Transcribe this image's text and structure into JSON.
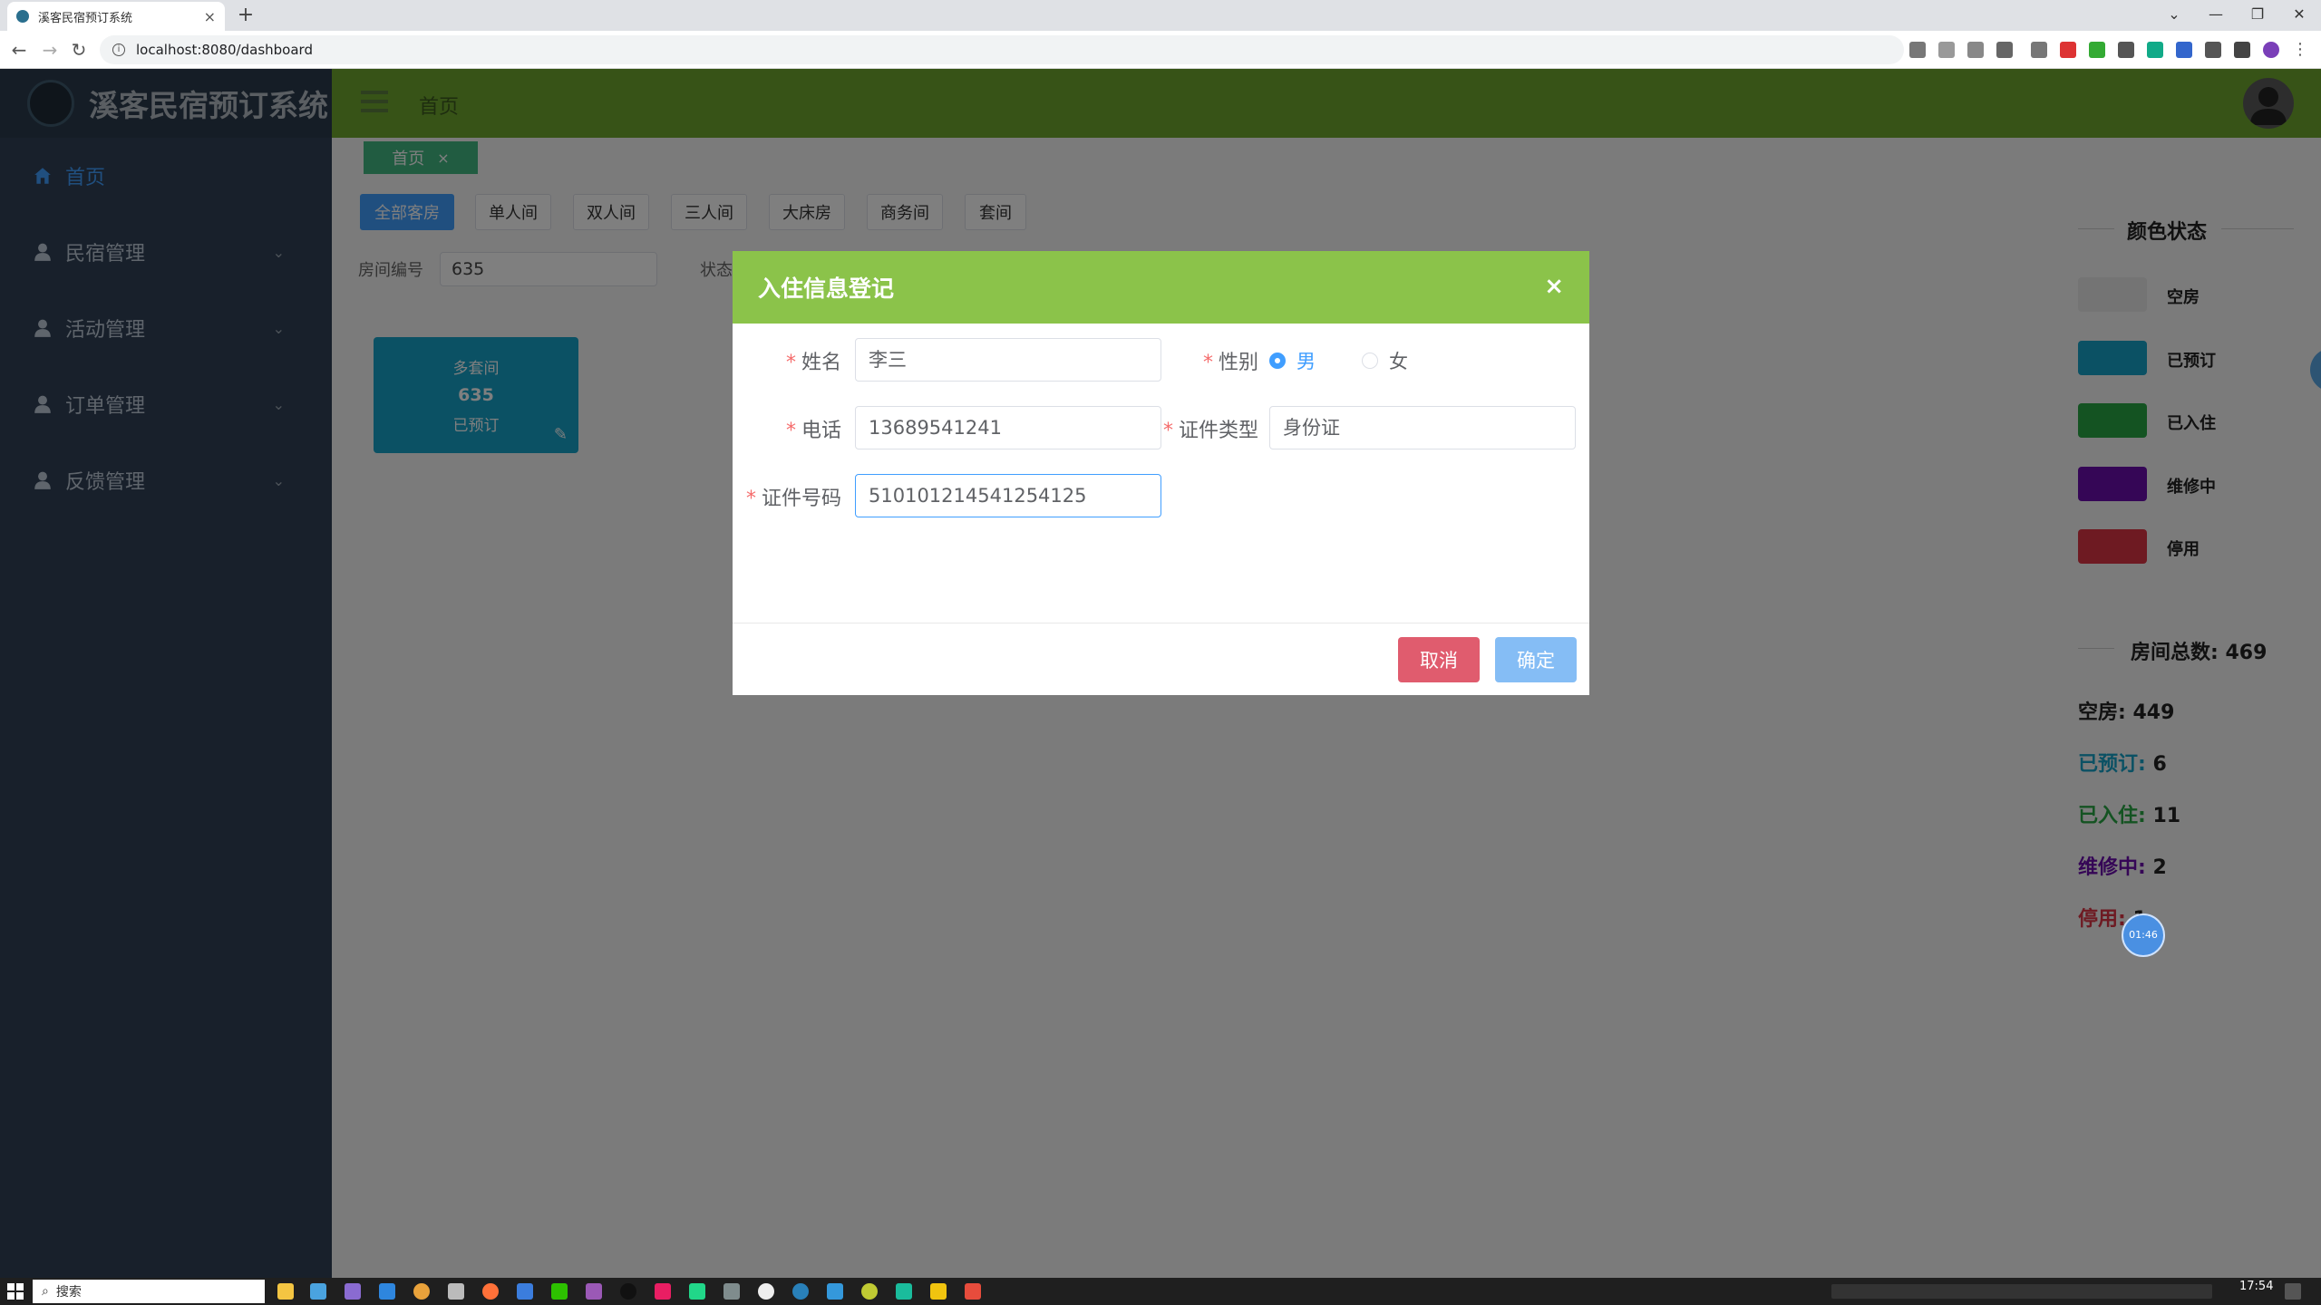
{
  "browser": {
    "tab_title": "溪客民宿预订系统",
    "tab_close": "×",
    "new_tab": "+",
    "url": "localhost:8080/dashboard",
    "window_controls": [
      "⌄",
      "—",
      "❐",
      "✕"
    ]
  },
  "app": {
    "title": "溪客民宿预订系统",
    "header_home": "首页",
    "menu": [
      {
        "label": "首页",
        "icon": "home-icon",
        "active": true
      },
      {
        "label": "民宿管理",
        "icon": "user-icon",
        "expandable": true
      },
      {
        "label": "活动管理",
        "icon": "user-icon",
        "expandable": true
      },
      {
        "label": "订单管理",
        "icon": "user-icon",
        "expandable": true
      },
      {
        "label": "反馈管理",
        "icon": "user-icon",
        "expandable": true
      }
    ],
    "menu_chevron": "⌄"
  },
  "tags": {
    "home": "首页",
    "close": "×"
  },
  "filters": [
    "全部客房",
    "单人间",
    "双人间",
    "三人间",
    "大床房",
    "商务间",
    "套间"
  ],
  "search": {
    "room_no_label": "房间编号",
    "room_no_value": "635",
    "status_label": "状态"
  },
  "room_card": {
    "type": "多套间",
    "number": "635",
    "status": "已预订"
  },
  "color_status": {
    "title": "颜色状态",
    "items": [
      {
        "label": "空房",
        "color": "#e8e8e8"
      },
      {
        "label": "已预订",
        "color": "#17a2c8"
      },
      {
        "label": "已入住",
        "color": "#28a745"
      },
      {
        "label": "维修中",
        "color": "#6a0dad"
      },
      {
        "label": "停用",
        "color": "#dc3545"
      }
    ]
  },
  "room_stats": {
    "total_label": "房间总数: 469",
    "rows": [
      {
        "label": "空房:",
        "value": "449",
        "color": "#222222"
      },
      {
        "label": "已预订:",
        "value": "6",
        "color": "#17a2c8"
      },
      {
        "label": "已入住:",
        "value": "11",
        "color": "#28a745"
      },
      {
        "label": "维修中:",
        "value": "2",
        "color": "#6a0dad"
      },
      {
        "label": "停用:",
        "value": "1",
        "color": "#dc3545"
      }
    ]
  },
  "dialog": {
    "title": "入住信息登记",
    "close": "×",
    "required_mark": "*",
    "name_label": "姓名",
    "name_value": "李三",
    "gender_label": "性别",
    "gender_male": "男",
    "gender_female": "女",
    "gender_selected": "男",
    "phone_label": "电话",
    "phone_value": "13689541241",
    "id_type_label": "证件类型",
    "id_type_value": "身份证",
    "id_no_label": "证件号码",
    "id_no_value": "510101214541254125",
    "cancel": "取消",
    "confirm": "确定"
  },
  "timer": "01:46",
  "taskbar": {
    "search_placeholder": "搜索",
    "time": "17:54"
  }
}
